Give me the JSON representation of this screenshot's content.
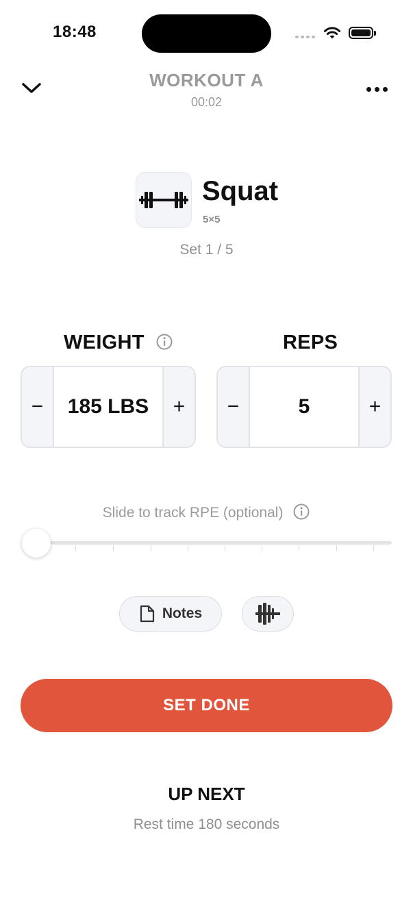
{
  "status_bar": {
    "time": "18:48"
  },
  "header": {
    "title": "WORKOUT A",
    "timer": "00:02"
  },
  "exercise": {
    "name": "Squat",
    "scheme": "5×5",
    "set_counter": "Set 1 / 5"
  },
  "weight": {
    "label": "WEIGHT",
    "value": "185 LBS",
    "minus": "−",
    "plus": "+"
  },
  "reps": {
    "label": "REPS",
    "value": "5",
    "minus": "−",
    "plus": "+"
  },
  "rpe": {
    "hint": "Slide to track RPE (optional)",
    "level": 0
  },
  "actions": {
    "notes_label": "Notes",
    "set_done_label": "SET DONE"
  },
  "up_next": {
    "title": "UP NEXT",
    "rest_text": "Rest time 180 seconds"
  },
  "icons": {
    "back": "chevron-down-icon",
    "more": "more-horizontal-icon",
    "exercise": "barbell-icon",
    "info": "info-icon",
    "notes": "document-icon",
    "plates": "plates-icon"
  },
  "colors": {
    "accent": "#e0553b",
    "muted_text": "#9a9a9a",
    "stepper_bg": "#f4f5f8"
  }
}
